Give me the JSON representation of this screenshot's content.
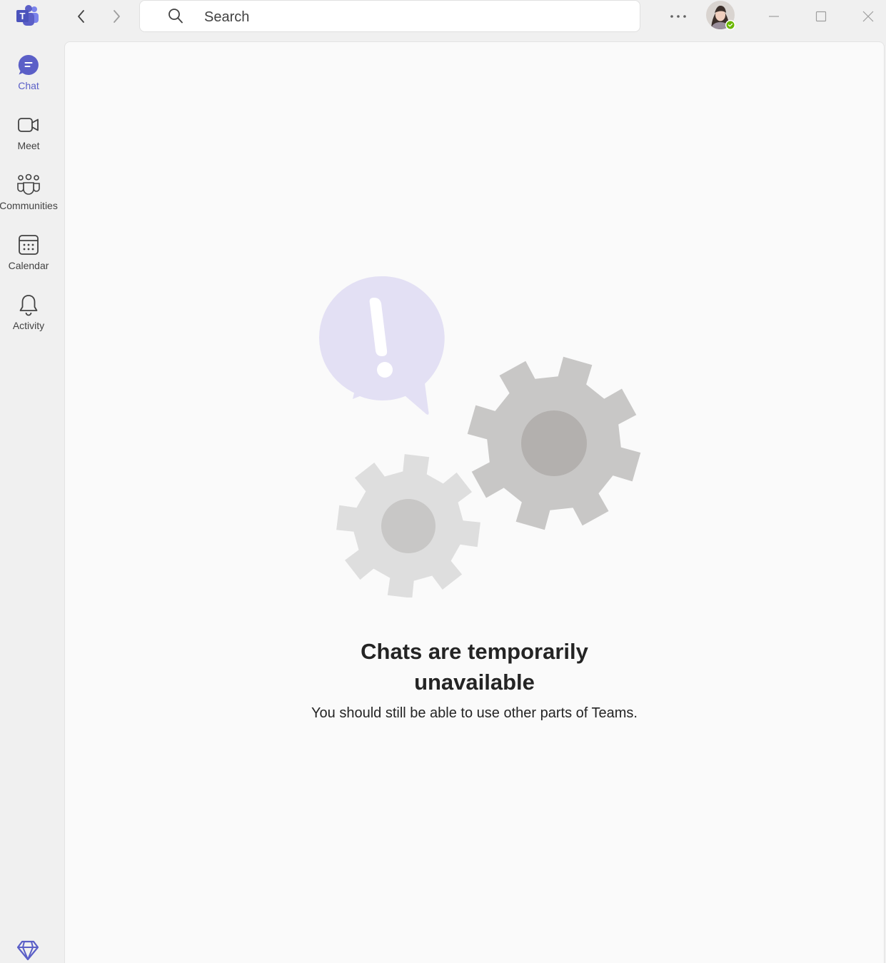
{
  "nav": {
    "items": [
      {
        "label": "Chat",
        "icon": "chat-icon",
        "active": true
      },
      {
        "label": "Meet",
        "icon": "video-camera-icon",
        "active": false
      },
      {
        "label": "Communities",
        "icon": "communities-icon",
        "active": false
      },
      {
        "label": "Calendar",
        "icon": "calendar-icon",
        "active": false
      },
      {
        "label": "Activity",
        "icon": "bell-icon",
        "active": false
      }
    ]
  },
  "search": {
    "placeholder": "Search"
  },
  "profile": {
    "status": "available"
  },
  "main": {
    "title_line1": "Chats are temporarily",
    "title_line2": "unavailable",
    "subtitle": "You should still be able to use other parts of Teams."
  },
  "colors": {
    "accent": "#5b5fc7",
    "bubble": "#e3e0f4",
    "gear_large": "#c8c7c6",
    "gear_small": "#dedede",
    "status_available": "#6bb700"
  }
}
